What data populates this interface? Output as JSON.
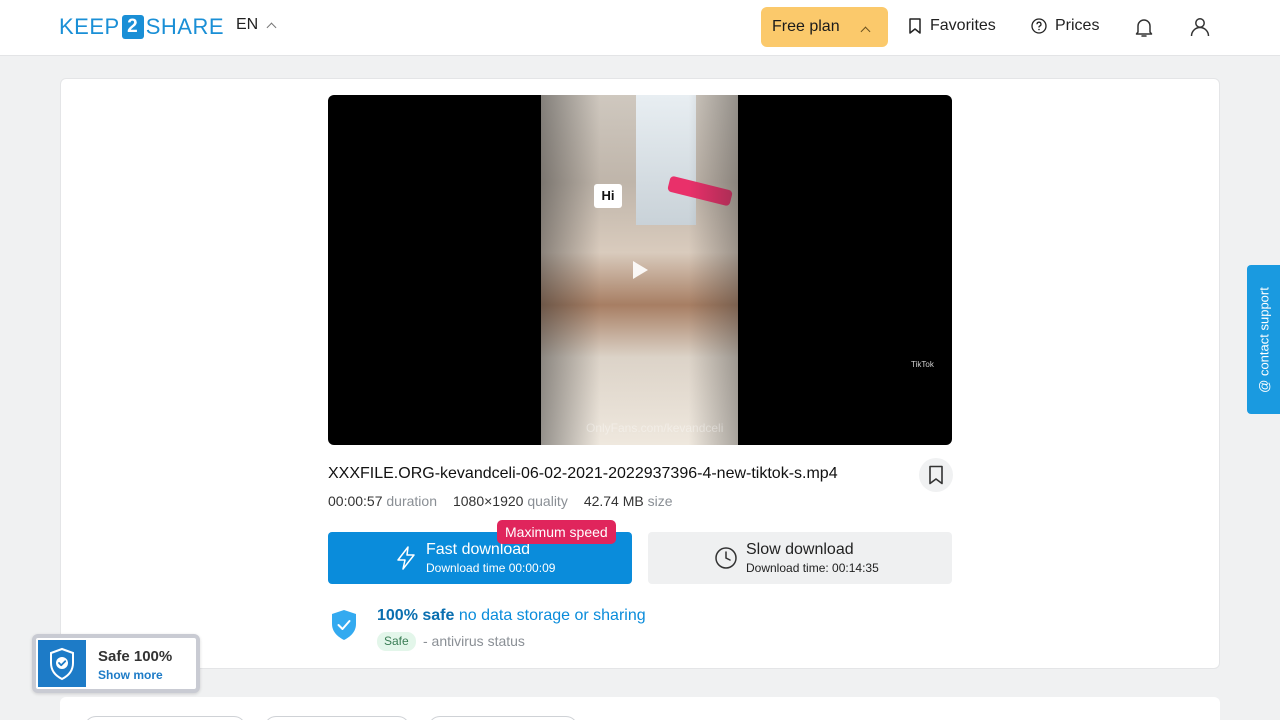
{
  "header": {
    "logo_left": "KEEP",
    "logo_mid": "2",
    "logo_right": "SHARE",
    "language": "EN",
    "plan_label": "Free plan",
    "favorites_label": "Favorites",
    "prices_label": "Prices",
    "icons": [
      "bookmark-icon",
      "question-circle-icon",
      "bell-icon",
      "user-icon"
    ]
  },
  "player": {
    "overlay_text": "Hi",
    "tiktok_mark": "TikTok",
    "watermark": "OnlyFans.com/kevandceli"
  },
  "file": {
    "name": "XXXFILE.ORG-kevandceli-06-02-2021-2022937396-4-new-tiktok-s.mp4",
    "duration": "00:00:57",
    "duration_label": "duration",
    "resolution": "1080×1920",
    "quality_label": "quality",
    "size": "42.74 MB",
    "size_label": "size"
  },
  "download": {
    "badge": "Maximum speed",
    "fast_title": "Fast download",
    "fast_sub": "Download time 00:00:09",
    "slow_title": "Slow download",
    "slow_sub": "Download time: 00:14:35"
  },
  "safety": {
    "bold": "100% safe",
    "rest": "no data storage or sharing",
    "tag": "Safe",
    "status": "- antivirus status"
  },
  "contact_label": "@ contact support",
  "widget": {
    "title": "Safe 100%",
    "link": "Show more"
  },
  "colors": {
    "brand_blue": "#0a8cdb",
    "plan_yellow": "#fbc96b",
    "badge_red": "#e0255c"
  }
}
